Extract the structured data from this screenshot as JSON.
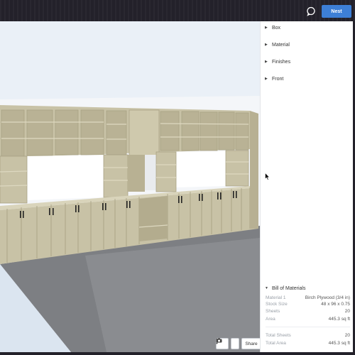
{
  "header": {
    "chat_icon": "chat-bubble-icon",
    "nest_label": "Nest",
    "accent": "#3d7fd6"
  },
  "panel": {
    "sections": [
      "Box",
      "Material",
      "Finishes",
      "Front"
    ],
    "bom": {
      "title": "Bill of Materials",
      "rows": [
        {
          "label": "Material 1",
          "value": "Birch Plywood (3/4 in)"
        },
        {
          "label": "Stock Size",
          "value": "48 x 96 x 0.75"
        },
        {
          "label": "Sheets",
          "value": "20"
        },
        {
          "label": "Area",
          "value": "445.3 sq ft"
        }
      ],
      "totals": [
        {
          "label": "Total Sheets",
          "value": "20"
        },
        {
          "label": "Total Area",
          "value": "445.3 sq ft"
        }
      ]
    }
  },
  "viewport": {
    "camera_icon": "camera-icon",
    "more_icon": "vertical-dots-icon",
    "share_label": "Share",
    "cabinet_color": "#c8c2a6",
    "floor_color": "#7d7f83"
  }
}
